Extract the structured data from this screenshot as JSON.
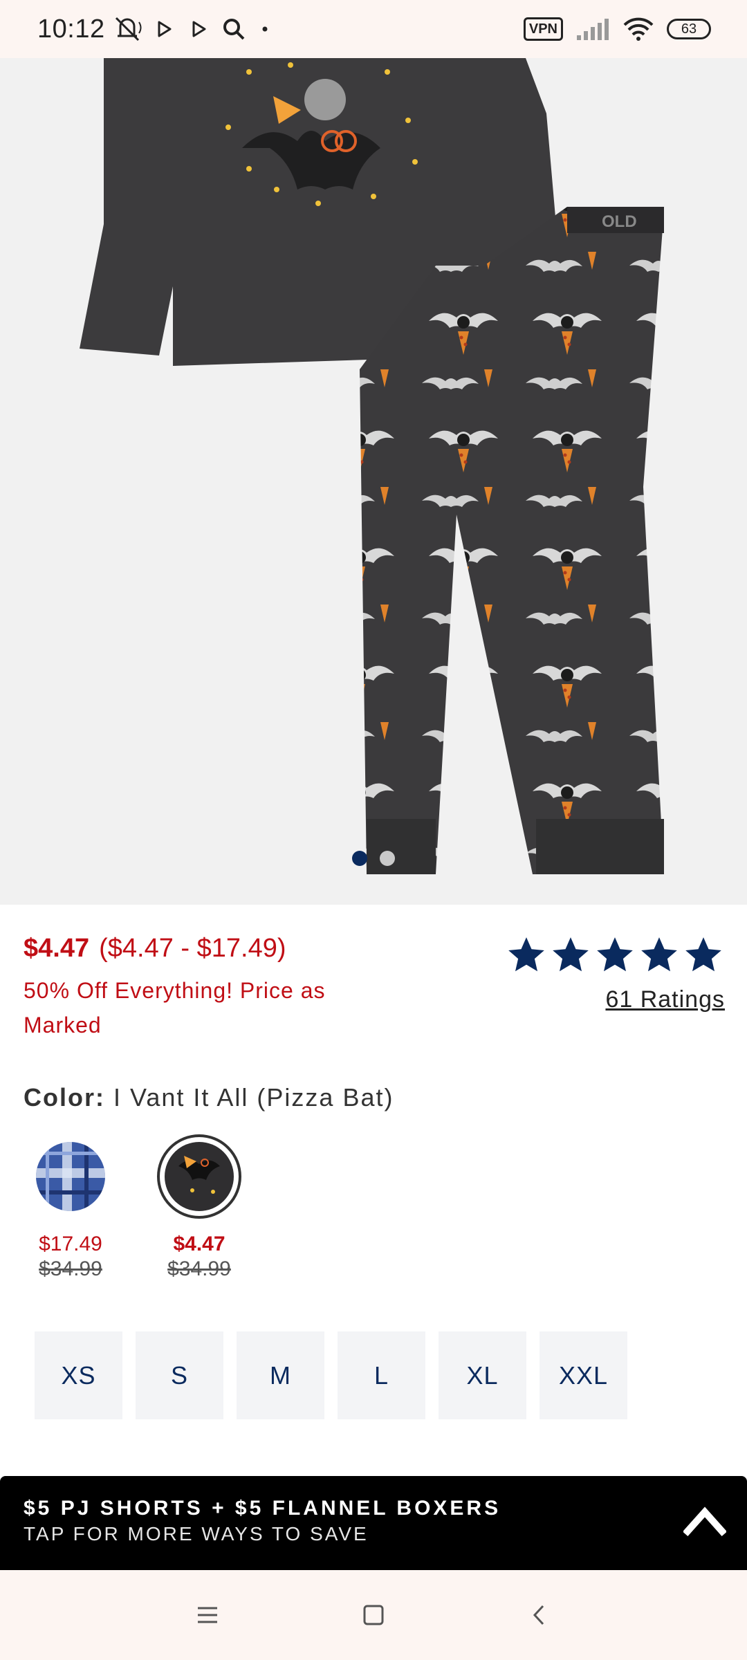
{
  "status_bar": {
    "time": "10:12",
    "vpn_label": "VPN",
    "battery": "63",
    "icons": [
      "mute-icon",
      "play-icon",
      "play-icon",
      "search-icon",
      "dot-icon",
      "vpn-icon",
      "signal-icon",
      "wifi-icon",
      "battery-icon"
    ]
  },
  "gallery": {
    "image_count": 2,
    "active_index": 0,
    "alt": "Kids pajama set with pizza bat print"
  },
  "product": {
    "price": "$4.47",
    "price_range": "($4.47 - $17.49)",
    "promo_text": "50% Off Everything! Price as Marked",
    "rating_stars": 5,
    "rating_count": "61 Ratings",
    "color_label": "Color:",
    "color_value": "I Vant It All (Pizza Bat)"
  },
  "swatches": [
    {
      "name": "blue plaid",
      "price": "$17.49",
      "original_price": "$34.99",
      "selected": false
    },
    {
      "name": "pizza bat",
      "price": "$4.47",
      "original_price": "$34.99",
      "selected": true
    }
  ],
  "sizes": [
    "XS",
    "S",
    "M",
    "L",
    "XL",
    "XXL"
  ],
  "promo_bar": {
    "title": "$5 PJ SHORTS + $5 FLANNEL BOXERS",
    "subtitle": "TAP FOR MORE WAYS TO SAVE"
  },
  "nav": {
    "icons": [
      "menu-icon",
      "home-icon",
      "back-icon"
    ]
  },
  "colors": {
    "sale_red": "#c00e15",
    "brand_navy": "#0a2a5e",
    "promo_bar_bg": "#000000"
  }
}
